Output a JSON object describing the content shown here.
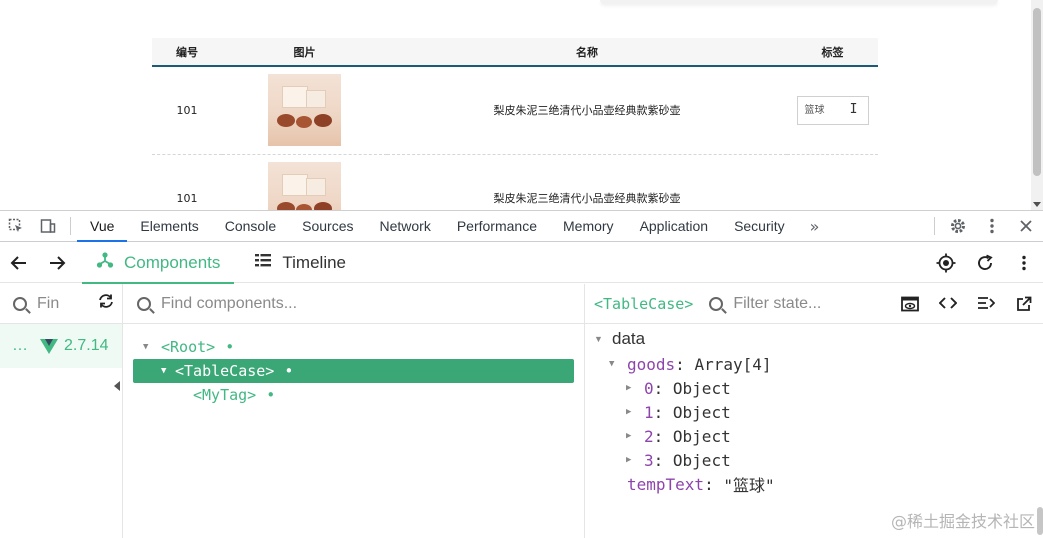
{
  "table": {
    "headers": [
      "编号",
      "图片",
      "名称",
      "标签"
    ],
    "rows": [
      {
        "id": "101",
        "name": "梨皮朱泥三绝清代小品壶经典款紫砂壶",
        "tag": "篮球"
      },
      {
        "id": "101",
        "name": "梨皮朱泥三绝清代小品壶经典款紫砂壶",
        "tag": ""
      }
    ]
  },
  "devtools": {
    "tabs": [
      "Vue",
      "Elements",
      "Console",
      "Sources",
      "Network",
      "Performance",
      "Memory",
      "Application",
      "Security"
    ],
    "more": "»"
  },
  "vue": {
    "tabs": {
      "components": "Components",
      "timeline": "Timeline"
    },
    "apps_search_placeholder": "Find apps...",
    "apps_search_visible": "Fin",
    "app_dots": "…",
    "app_version": "2.7.14",
    "component_search_placeholder": "Find components...",
    "tree": [
      {
        "name": "<Root>",
        "level": 0,
        "expanded": true,
        "selected": false
      },
      {
        "name": "<TableCase>",
        "level": 1,
        "expanded": true,
        "selected": true
      },
      {
        "name": "<MyTag>",
        "level": 2,
        "expanded": false,
        "selected": false
      }
    ],
    "tree_dot": "•",
    "state": {
      "component": "<TableCase>",
      "filter_placeholder": "Filter state...",
      "section": "data",
      "goods_key": "goods",
      "goods_value": "Array[4]",
      "items": [
        {
          "key": "0",
          "value": "Object"
        },
        {
          "key": "1",
          "value": "Object"
        },
        {
          "key": "2",
          "value": "Object"
        },
        {
          "key": "3",
          "value": "Object"
        }
      ],
      "temp_key": "tempText",
      "temp_value": "\"篮球\""
    }
  },
  "watermark": "@稀土掘金技术社区",
  "colors": {
    "vue_green": "#42b883",
    "selected_row": "#3ba776",
    "active_tab": "#1a73e8"
  }
}
